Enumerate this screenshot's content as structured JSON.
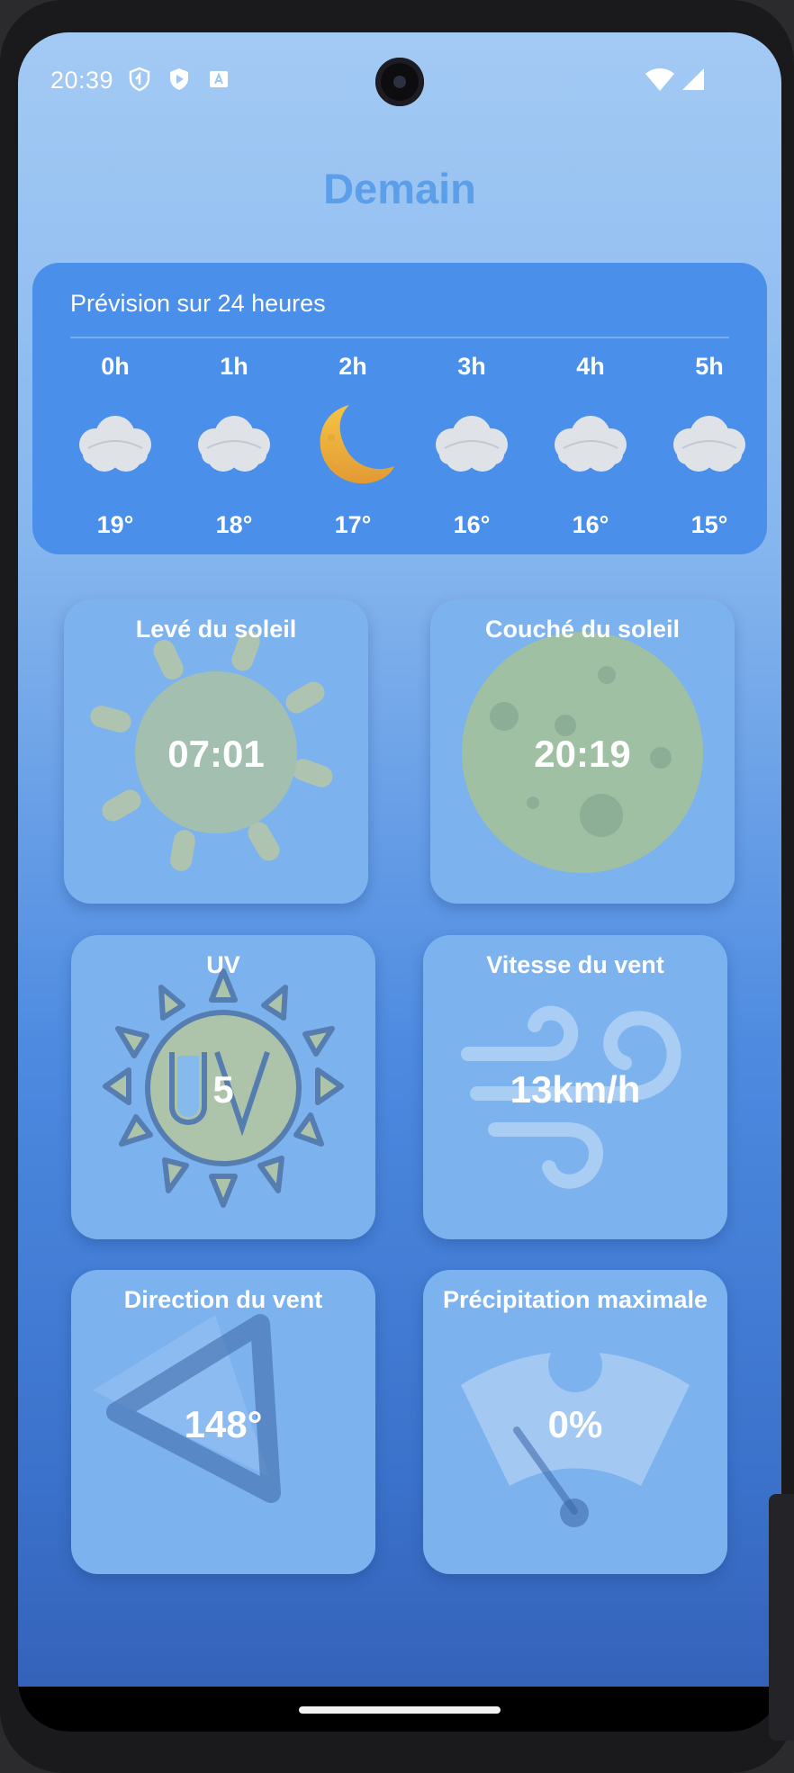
{
  "status_bar": {
    "time": "20:39",
    "icons": [
      "shield-icon",
      "play-protect-icon",
      "keyboard-icon"
    ],
    "right_icons": [
      "wifi-icon",
      "signal-icon"
    ]
  },
  "page_title": "Demain",
  "forecast": {
    "title": "Prévision sur 24 heures",
    "hours": [
      {
        "label": "0h",
        "icon": "cloud-icon",
        "temp": "19°"
      },
      {
        "label": "1h",
        "icon": "cloud-icon",
        "temp": "18°"
      },
      {
        "label": "2h",
        "icon": "moon-icon",
        "temp": "17°"
      },
      {
        "label": "3h",
        "icon": "cloud-icon",
        "temp": "16°"
      },
      {
        "label": "4h",
        "icon": "cloud-icon",
        "temp": "16°"
      },
      {
        "label": "5h",
        "icon": "cloud-icon",
        "temp": "15°"
      }
    ]
  },
  "tiles": {
    "sunrise": {
      "title": "Levé du soleil",
      "value": "07:01",
      "icon": "sun-icon"
    },
    "sunset": {
      "title": "Couché du soleil",
      "value": "20:19",
      "icon": "moon-full-icon"
    },
    "uv": {
      "title": "UV",
      "value": "5",
      "icon": "uv-sun-icon"
    },
    "wind_speed": {
      "title": "Vitesse du vent",
      "value": "13km/h",
      "icon": "wind-icon"
    },
    "wind_direction": {
      "title": "Direction du vent",
      "value": "148°",
      "icon": "direction-arrow-icon"
    },
    "precipitation": {
      "title": "Précipitation maximale",
      "value": "0%",
      "icon": "gauge-icon"
    }
  },
  "colors": {
    "title": "#5b9ee9",
    "forecast_card": "#4a8fe9",
    "tile": "#7cb2ee"
  }
}
